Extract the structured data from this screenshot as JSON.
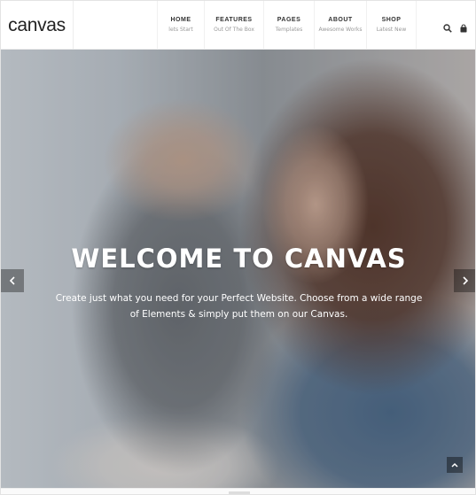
{
  "brand": {
    "logo_text": "canvas"
  },
  "nav": {
    "items": [
      {
        "title": "HOME",
        "subtitle": "lets Start"
      },
      {
        "title": "FEATURES",
        "subtitle": "Out Of The Box"
      },
      {
        "title": "PAGES",
        "subtitle": "Templates"
      },
      {
        "title": "ABOUT",
        "subtitle": "Awesome Works"
      },
      {
        "title": "SHOP",
        "subtitle": "Latest New"
      }
    ]
  },
  "tools": {
    "search_icon": "search-icon",
    "cart_icon": "cart-icon"
  },
  "hero": {
    "title": "WELCOME TO CANVAS",
    "text": "Create just what you need for your Perfect Website. Choose from a wide range of Elements & simply put them on our Canvas."
  },
  "colors": {
    "text_dark": "#333333",
    "subtitle_gray": "#999999",
    "hero_text": "#ffffff"
  }
}
